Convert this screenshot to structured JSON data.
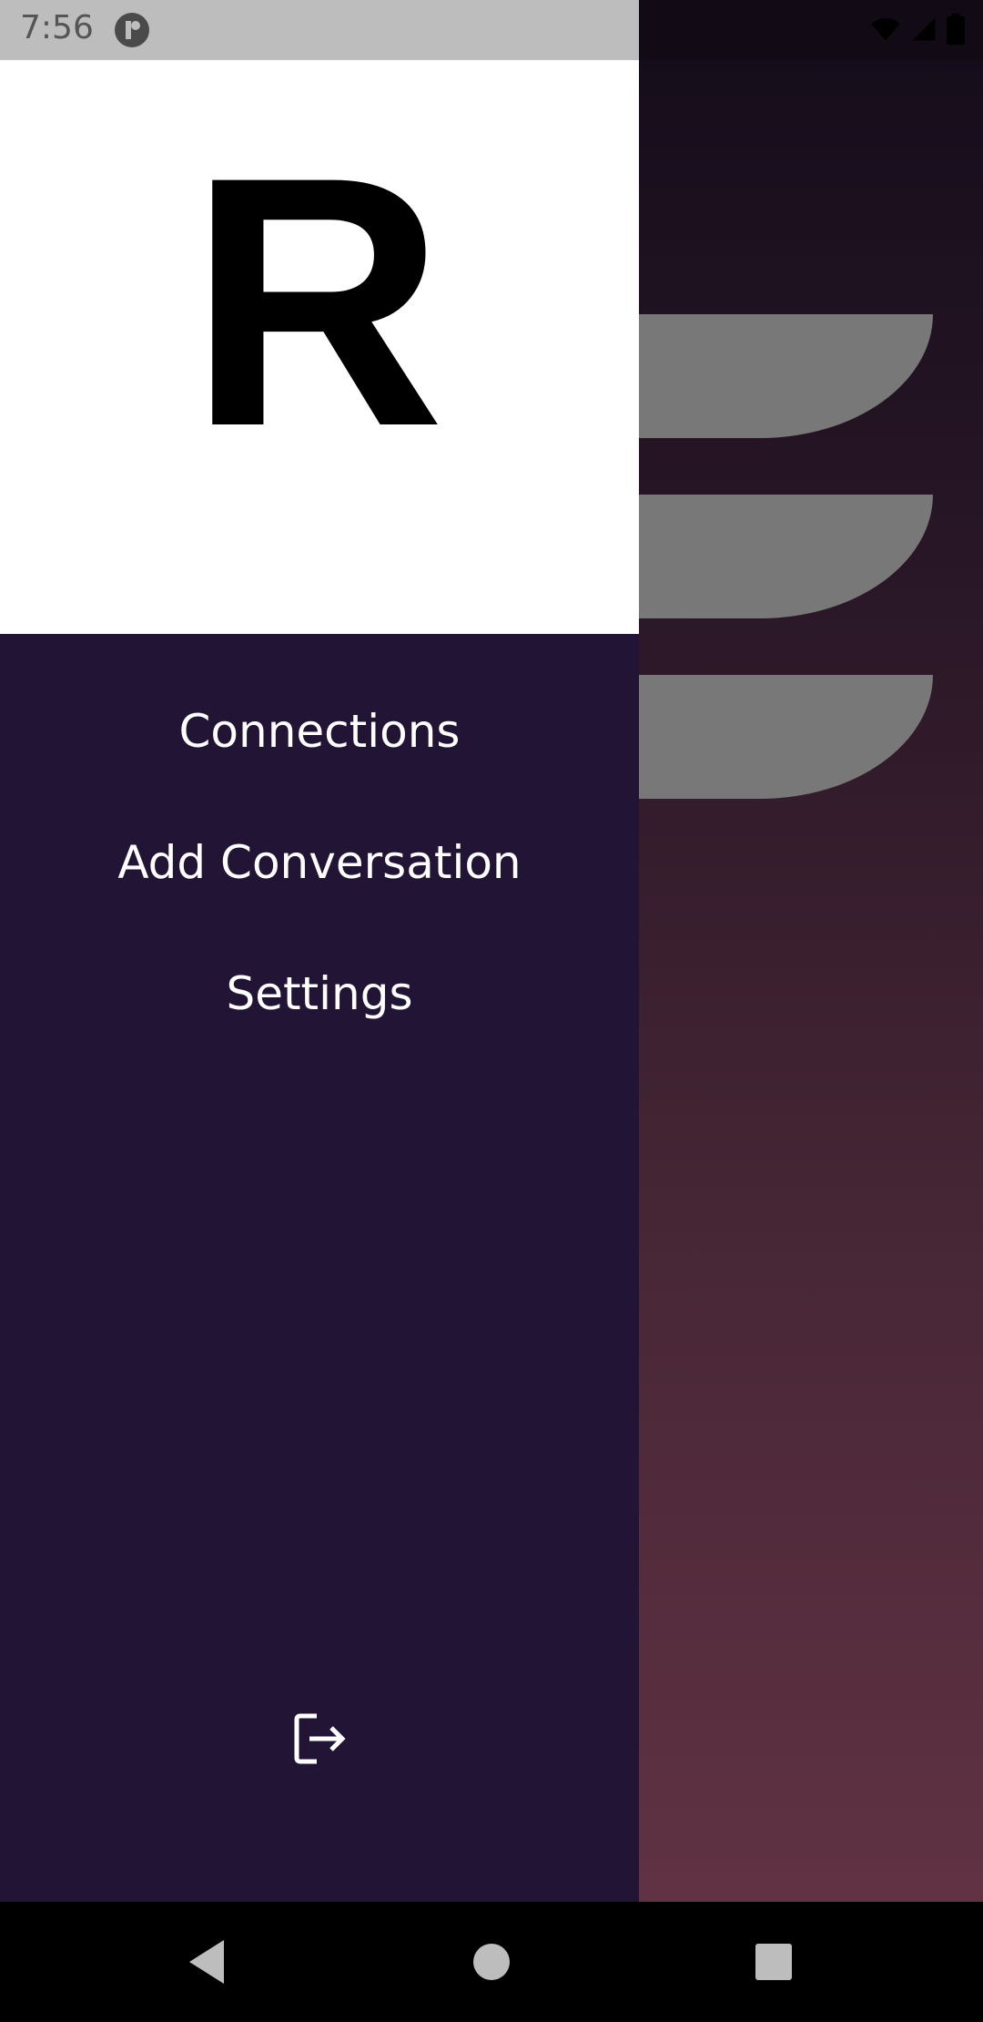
{
  "status_bar": {
    "time": "7:56",
    "icons": [
      "app-notification-icon",
      "wifi-icon",
      "signal-icon",
      "battery-icon"
    ]
  },
  "drawer": {
    "logo_letter": "R",
    "menu": [
      {
        "label": "Connections"
      },
      {
        "label": "Add Conversation"
      },
      {
        "label": "Settings"
      }
    ],
    "logout_icon": "logout-icon"
  },
  "nav_bar": {
    "icons": [
      "back-icon",
      "home-icon",
      "recents-icon"
    ]
  },
  "colors": {
    "drawer_background": "#221434",
    "header_background": "#ffffff",
    "menu_text": "#ffffff",
    "scrim_shapes": "#787878"
  }
}
